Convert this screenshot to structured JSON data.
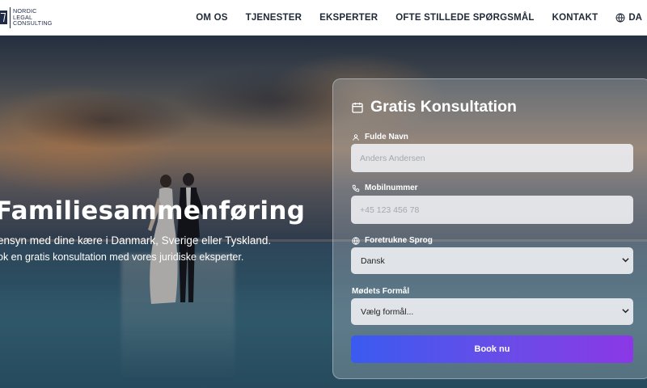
{
  "logo": {
    "line1": "NORDIC",
    "line2": "LEGAL",
    "line3": "CONSULTING"
  },
  "nav": {
    "items": [
      {
        "label": "OM OS"
      },
      {
        "label": "TJENESTER"
      },
      {
        "label": "EKSPERTER"
      },
      {
        "label": "OFTE STILLEDE SPØRGSMÅL"
      },
      {
        "label": "KONTAKT"
      }
    ],
    "language": "DA",
    "language_icon": "globe-icon"
  },
  "hero": {
    "title": "Familiesammenføring",
    "subtitle1": "ensyn med dine kære i Danmark, Sverige eller Tyskland.",
    "subtitle2": "ok en gratis konsultation med vores juridiske eksperter."
  },
  "form": {
    "title": "Gratis Konsultation",
    "title_icon": "calendar-icon",
    "name": {
      "label": "Fulde Navn",
      "placeholder": "Anders Andersen",
      "icon": "user-icon"
    },
    "phone": {
      "label": "Mobilnummer",
      "placeholder": "+45 123 456 78",
      "icon": "phone-icon"
    },
    "language": {
      "label": "Foretrukne Sprog",
      "value": "Dansk",
      "icon": "globe-icon"
    },
    "purpose": {
      "label": "Mødets Formål",
      "value": "Vælg formål..."
    },
    "submit_label": "Book nu"
  },
  "colors": {
    "button_start": "#3a5bf0",
    "button_end": "#8b38e6",
    "nav_text": "#1f2937"
  }
}
